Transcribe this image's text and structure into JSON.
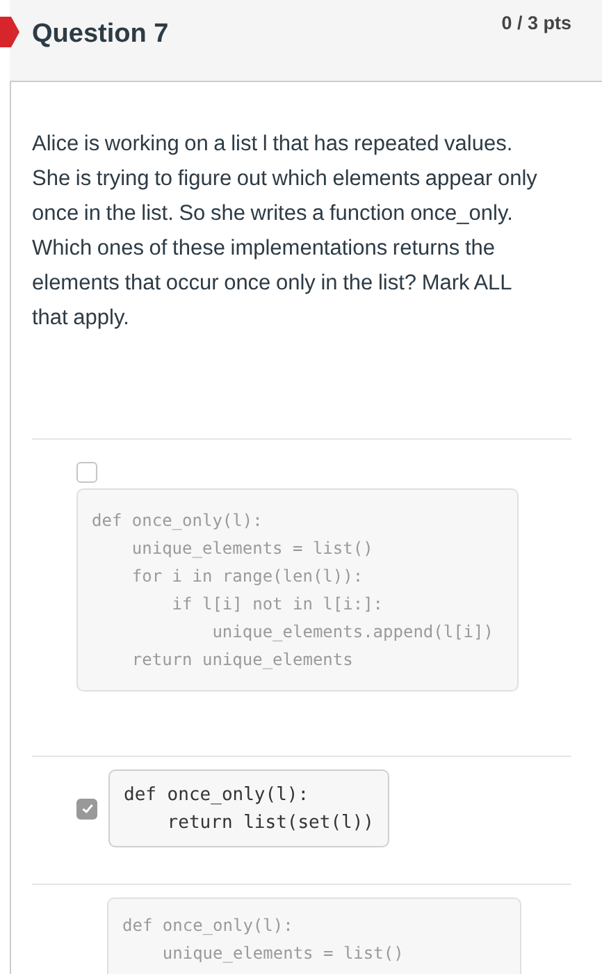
{
  "header": {
    "title": "Question 7",
    "points": "0 / 3 pts"
  },
  "question": "Alice is working on a list l that has repeated values. She is trying to figure out which elements appear only once in the list.  So she writes a function once_only.  Which ones of these implementations returns the elements that occur once only in the list? Mark ALL that apply.",
  "options": [
    {
      "kind": "stacked",
      "checked": false,
      "code": [
        "def once_only(l):",
        "    unique_elements = list()",
        "    for i in range(len(l)):",
        "        if l[i] not in l[i:]:",
        "            unique_elements.append(l[i])",
        "    return unique_elements"
      ]
    },
    {
      "kind": "inline",
      "checked": true,
      "code": [
        "def once_only(l):",
        "    return list(set(l))"
      ]
    },
    {
      "kind": "clipped",
      "code": [
        "def once_only(l):",
        "    unique_elements = list()"
      ]
    }
  ]
}
